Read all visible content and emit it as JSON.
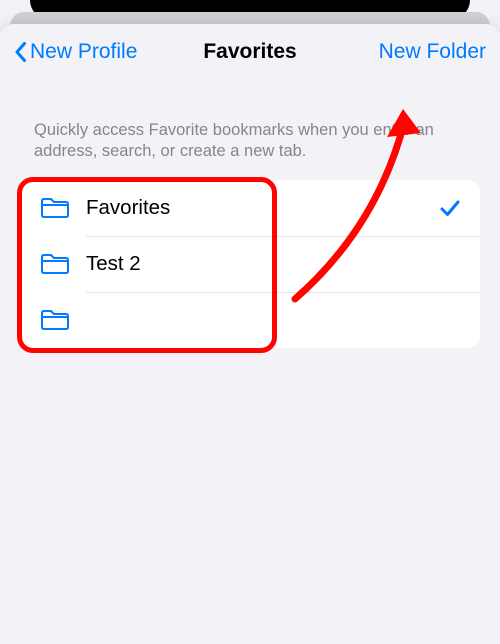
{
  "nav": {
    "back_label": "New Profile",
    "title": "Favorites",
    "right_label": "New Folder"
  },
  "description": "Quickly access Favorite bookmarks when you enter an address, search, or create a new tab.",
  "folders": [
    {
      "name": "Favorites",
      "selected": true
    },
    {
      "name": "Test 2",
      "selected": false
    },
    {
      "name": "",
      "selected": false
    }
  ],
  "colors": {
    "accent": "#007aff",
    "annotation": "#ff0400"
  }
}
